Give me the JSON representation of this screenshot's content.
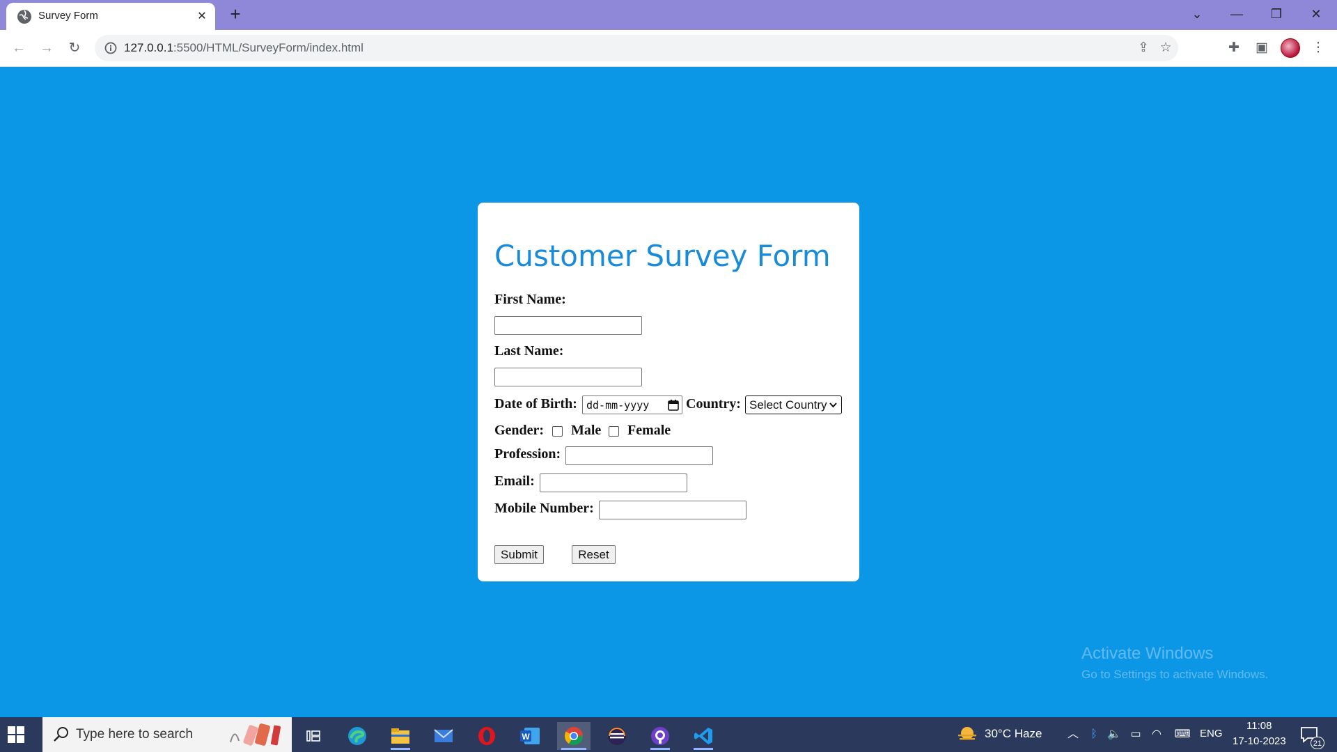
{
  "browser": {
    "tab_title": "Survey Form",
    "url_host": "127.0.0.1",
    "url_rest": ":5500/HTML/SurveyForm/index.html"
  },
  "form": {
    "title": "Customer Survey Form",
    "first_name_label": "First Name:",
    "last_name_label": "Last Name:",
    "dob_label": "Date of Birth:",
    "dob_placeholder": "dd-mm-yyyy",
    "country_label": "Country:",
    "country_selected": "Select Country",
    "gender_label": "Gender:",
    "gender_options": [
      "Male",
      "Female"
    ],
    "profession_label": "Profession:",
    "email_label": "Email:",
    "mobile_label": "Mobile Number:",
    "submit_label": "Submit",
    "reset_label": "Reset"
  },
  "watermark": {
    "line1": "Activate Windows",
    "line2": "Go to Settings to activate Windows."
  },
  "taskbar": {
    "search_placeholder": "Type here to search",
    "weather": "30°C  Haze",
    "language": "ENG",
    "time": "11:08",
    "date": "17-10-2023",
    "notification_count": "21"
  },
  "colors": {
    "page_background": "#0c96e6",
    "title_blue": "#1a8bd8",
    "tabstrip": "#8f87d8",
    "taskbar": "#2b3a5c"
  }
}
